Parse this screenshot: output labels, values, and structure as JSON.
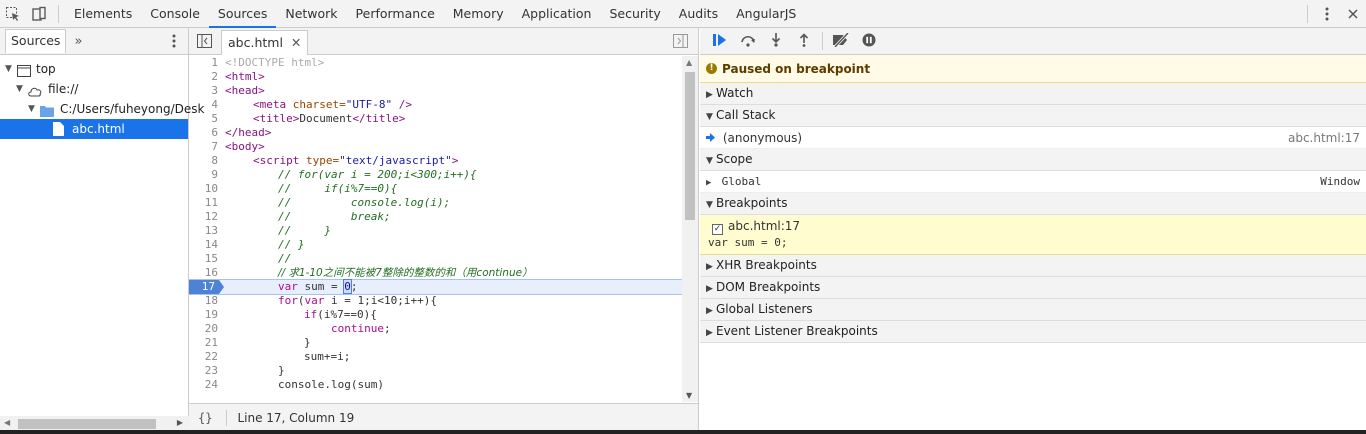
{
  "toolbar": {
    "tabs": [
      "Elements",
      "Console",
      "Sources",
      "Network",
      "Performance",
      "Memory",
      "Application",
      "Security",
      "Audits",
      "AngularJS"
    ],
    "active_tab": "Sources"
  },
  "navigator": {
    "tab_label": "Sources",
    "tree": [
      {
        "label": "top"
      },
      {
        "label": "file://"
      },
      {
        "label": "C:/Users/fuheyong/Desk"
      },
      {
        "label": "abc.html"
      }
    ]
  },
  "editor": {
    "file_tab": "abc.html",
    "status": "Line 17, Column 19",
    "lines": [
      {
        "n": "1"
      },
      {
        "n": "2"
      },
      {
        "n": "3"
      },
      {
        "n": "4"
      },
      {
        "n": "5"
      },
      {
        "n": "6"
      },
      {
        "n": "7"
      },
      {
        "n": "8"
      },
      {
        "n": "9"
      },
      {
        "n": "10"
      },
      {
        "n": "11"
      },
      {
        "n": "12"
      },
      {
        "n": "13"
      },
      {
        "n": "14"
      },
      {
        "n": "15"
      },
      {
        "n": "16"
      },
      {
        "n": "17"
      },
      {
        "n": "18"
      },
      {
        "n": "19"
      },
      {
        "n": "20"
      },
      {
        "n": "21"
      },
      {
        "n": "22"
      },
      {
        "n": "23"
      },
      {
        "n": "24"
      }
    ],
    "code": {
      "l1": "<!DOCTYPE html>",
      "l2": "<html>",
      "l3": "<head>",
      "l4_tag_open": "<meta",
      "l4_attr": "charset=",
      "l4_val": "\"UTF-8\"",
      "l4_tag_close": "/>",
      "l5_open": "<title>",
      "l5_text": "Document",
      "l5_close": "</title>",
      "l6": "</head>",
      "l7": "<body>",
      "l8_tag_open": "<script",
      "l8_attr": "type=",
      "l8_val": "\"text/javascript\"",
      "l8_tag_close": ">",
      "l9": "// for(var i = 200;i<300;i++){",
      "l10": "//     if(i%7==0){",
      "l11": "//         console.log(i);",
      "l12": "//         break;",
      "l13": "//     }",
      "l14": "// }",
      "l15": "//",
      "l16": "// 求1-10之间不能被7整除的整数的和（用continue）",
      "l17_kw": "var",
      "l17_a": "sum = ",
      "l17_num": "0",
      "l17_b": ";",
      "l18_kw": "for",
      "l18_a": "(",
      "l18_kw2": "var",
      "l18_b": " i = 1;i<10;i++){",
      "l19_kw": "if",
      "l19_a": "(i%7==0){",
      "l20_kw": "continue",
      "l20_a": ";",
      "l21": "}",
      "l22": "sum+=i;",
      "l23": "}",
      "l24": "console.log(sum)"
    }
  },
  "debugger": {
    "paused_message": "Paused on breakpoint",
    "sections": {
      "watch": "Watch",
      "call_stack": "Call Stack",
      "scope": "Scope",
      "breakpoints": "Breakpoints",
      "xhr": "XHR Breakpoints",
      "dom": "DOM Breakpoints",
      "global_listeners": "Global Listeners",
      "event_listener": "Event Listener Breakpoints"
    },
    "call_stack_frame": {
      "name": "(anonymous)",
      "location": "abc.html:17"
    },
    "scope_global": {
      "name": "Global",
      "value": "Window"
    },
    "breakpoint": {
      "location": "abc.html:17",
      "code": "var sum = 0;"
    }
  },
  "colors": {
    "accent": "#1a73e8",
    "paused_bg": "#fffbe6",
    "breakpoint_bg": "#fffcd0"
  }
}
